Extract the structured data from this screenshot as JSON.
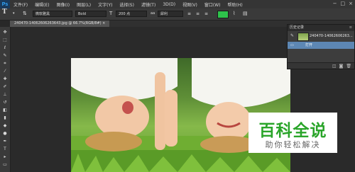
{
  "app": {
    "logo": "Ps"
  },
  "menubar": {
    "items": [
      "文件(F)",
      "编辑(E)",
      "图像(I)",
      "图层(L)",
      "文字(Y)",
      "选择(S)",
      "滤镜(T)",
      "3D(D)",
      "视图(V)",
      "窗口(W)",
      "帮助(H)"
    ],
    "window_controls": [
      "−",
      "□",
      "×"
    ]
  },
  "options_bar": {
    "font_family": "微软雅黑",
    "font_style": "Bold",
    "font_size": "200 点",
    "antialias": "犀利",
    "text_color": "#2ec24b"
  },
  "document": {
    "tab_title": "240470-14062606263643.jpg @ 66.7%(RGB/8#) ×"
  },
  "history_panel": {
    "title": "历史记录",
    "snapshot_name": "240470-14062606263...",
    "step": "打开"
  },
  "watermark": {
    "title": "百科全说",
    "subtitle": "助你轻松解决",
    "color": "#2aa52a"
  }
}
